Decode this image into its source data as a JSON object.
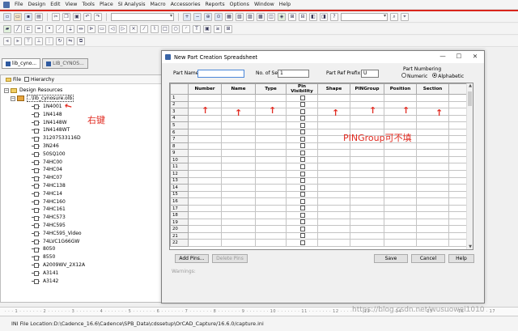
{
  "menu": [
    "File",
    "Design",
    "Edit",
    "View",
    "Tools",
    "Place",
    "SI Analysis",
    "Macro",
    "Accessories",
    "Reports",
    "Options",
    "Window",
    "Help"
  ],
  "project_tabs": [
    "lib_cyno...",
    "LIB_CYNOS..."
  ],
  "panel_tabs": {
    "file": "File",
    "hierarchy": "Hierarchy"
  },
  "tree": {
    "root": "Design Resources",
    "library": "..\\lib_cynosure.olb",
    "parts": [
      "1N4001",
      "1N4148",
      "1N4148W",
      "1N4148WT",
      "31207533116D",
      "3N246",
      "50SQ100",
      "74HC00",
      "74HC04",
      "74HC07",
      "74HC138",
      "74HC14",
      "74HC160",
      "74HC161",
      "74HC573",
      "74HC595",
      "74HC595_Video",
      "74LVC1G66GW",
      "8050",
      "8550",
      "A2009WV_2X12A",
      "A3141",
      "A3142"
    ]
  },
  "annotations": {
    "right_click": "右键",
    "pingroup": "PINGroup可不填",
    "arrow": "↑"
  },
  "dialog": {
    "title": "New Part Creation Spreadsheet",
    "part_name_label": "Part Name:",
    "part_name_value": "",
    "sections_label": "No. of Sections:",
    "sections_value": "1",
    "prefix_label": "Part Ref Prefix:",
    "prefix_value": "U",
    "numbering_label": "Part Numbering",
    "numeric_label": "Numeric",
    "alphabetic_label": "Alphabetic",
    "columns": [
      "Number",
      "Name",
      "Type",
      "Pin Visibility",
      "Shape",
      "PINGroup",
      "Position",
      "Section"
    ],
    "rows": [
      "1",
      "2",
      "3",
      "4",
      "5",
      "6",
      "7",
      "8",
      "9",
      "10",
      "11",
      "12",
      "13",
      "14",
      "15",
      "16",
      "17",
      "18",
      "19",
      "20",
      "21",
      "22"
    ],
    "add_pins": "Add Pins...",
    "delete_pins": "Delete Pins",
    "save": "Save",
    "cancel": "Cancel",
    "help": "Help",
    "warnings": "Warnings:"
  },
  "statusbar": {
    "ini": "INI File Location:D:\\Cadence_16.6\\Cadence\\SPB_Data\\cdssetup\\OrCAD_Capture/16.6.0/capture.ini"
  },
  "watermark": "https://blog.csdn.net/wusuowei1010",
  "colors": {
    "annotation": "#e12a20",
    "accent": "#3964a6"
  }
}
